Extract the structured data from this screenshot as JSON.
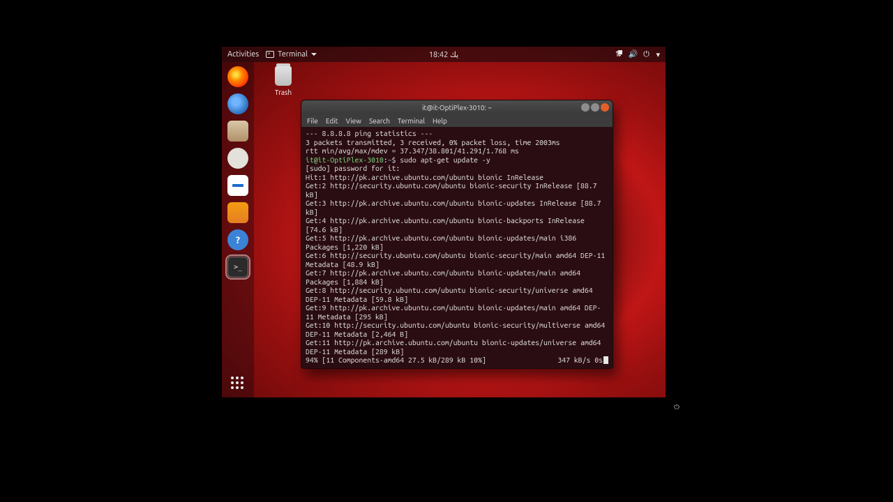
{
  "topbar": {
    "activities": "Activities",
    "app_label": "Terminal",
    "clock": "18:42 يك"
  },
  "status_icons": {
    "network": "⇅",
    "sound": "🔊",
    "power": "⏻",
    "caret": "▾"
  },
  "desktop": {
    "trash_label": "Trash"
  },
  "dock": {
    "items": [
      {
        "name": "firefox"
      },
      {
        "name": "thunderbird"
      },
      {
        "name": "files"
      },
      {
        "name": "rhythmbox"
      },
      {
        "name": "writer"
      },
      {
        "name": "software"
      },
      {
        "name": "help"
      },
      {
        "name": "terminal"
      }
    ],
    "help_glyph": "?"
  },
  "terminal": {
    "title": "it@it-OptiPlex-3010: ~",
    "menus": [
      "File",
      "Edit",
      "View",
      "Search",
      "Terminal",
      "Help"
    ],
    "prompt_user": "it@it-OptiPlex-3010",
    "prompt_sep": ":",
    "prompt_path": "~",
    "prompt_sigil": "$",
    "command": "sudo apt-get update -y",
    "lines_pre": [
      "--- 8.8.8.8 ping statistics ---",
      "3 packets transmitted, 3 received, 0% packet loss, time 2003ms",
      "rtt min/avg/max/mdev = 37.347/38.801/41.291/1.768 ms"
    ],
    "lines_post": [
      "[sudo] password for it:",
      "Hit:1 http://pk.archive.ubuntu.com/ubuntu bionic InRelease",
      "Get:2 http://security.ubuntu.com/ubuntu bionic-security InRelease [88.7 kB]",
      "Get:3 http://pk.archive.ubuntu.com/ubuntu bionic-updates InRelease [88.7 kB]",
      "Get:4 http://pk.archive.ubuntu.com/ubuntu bionic-backports InRelease [74.6 kB]",
      "Get:5 http://pk.archive.ubuntu.com/ubuntu bionic-updates/main i386 Packages [1,220 kB]",
      "Get:6 http://security.ubuntu.com/ubuntu bionic-security/main amd64 DEP-11 Metadata [48.9 kB]",
      "Get:7 http://pk.archive.ubuntu.com/ubuntu bionic-updates/main amd64 Packages [1,884 kB]",
      "Get:8 http://security.ubuntu.com/ubuntu bionic-security/universe amd64 DEP-11 Metadata [59.8 kB]",
      "Get:9 http://pk.archive.ubuntu.com/ubuntu bionic-updates/main amd64 DEP-11 Metadata [295 kB]",
      "Get:10 http://security.ubuntu.com/ubuntu bionic-security/multiverse amd64 DEP-11 Metadata [2,464 B]",
      "Get:11 http://pk.archive.ubuntu.com/ubuntu bionic-updates/universe amd64 DEP-11 Metadata [289 kB]"
    ],
    "progress_left": "94% [11 Components-amd64 27.5 kB/289 kB 10%]",
    "progress_right": "347 kB/s 0s"
  }
}
